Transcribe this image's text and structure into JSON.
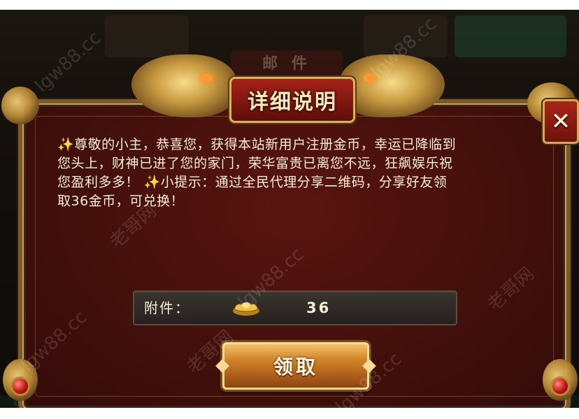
{
  "dialog": {
    "title": "详细说明",
    "close_icon": "close-icon",
    "close_label": "✕",
    "description": {
      "sparkle_icon": "sparkle-icon",
      "line1": "尊敬的小主，恭喜您，获得本站新用户注册金币，幸运已降临到",
      "line2": "您头上，财神已进了您的家门，荣华富贵已离您不远，狂飙娱乐祝",
      "line3a": "您盈利多多！",
      "line3b": "小提示：通过全民代理分享二维码，分享好友领",
      "line4": "取36金币，可兑换！"
    },
    "attachment": {
      "label": "附件：",
      "item_icon": "gold-ingot-icon",
      "amount": "36"
    },
    "claim_button": "领取"
  },
  "background": {
    "tab_text": "邮 件"
  },
  "watermark": {
    "text_cn": "老哥网",
    "text_en": "lgw88.cc"
  },
  "colors": {
    "panel": "#43100c",
    "gold": "#c9a25a",
    "text": "#fbeed6",
    "sparkle": "#f3d36a"
  }
}
